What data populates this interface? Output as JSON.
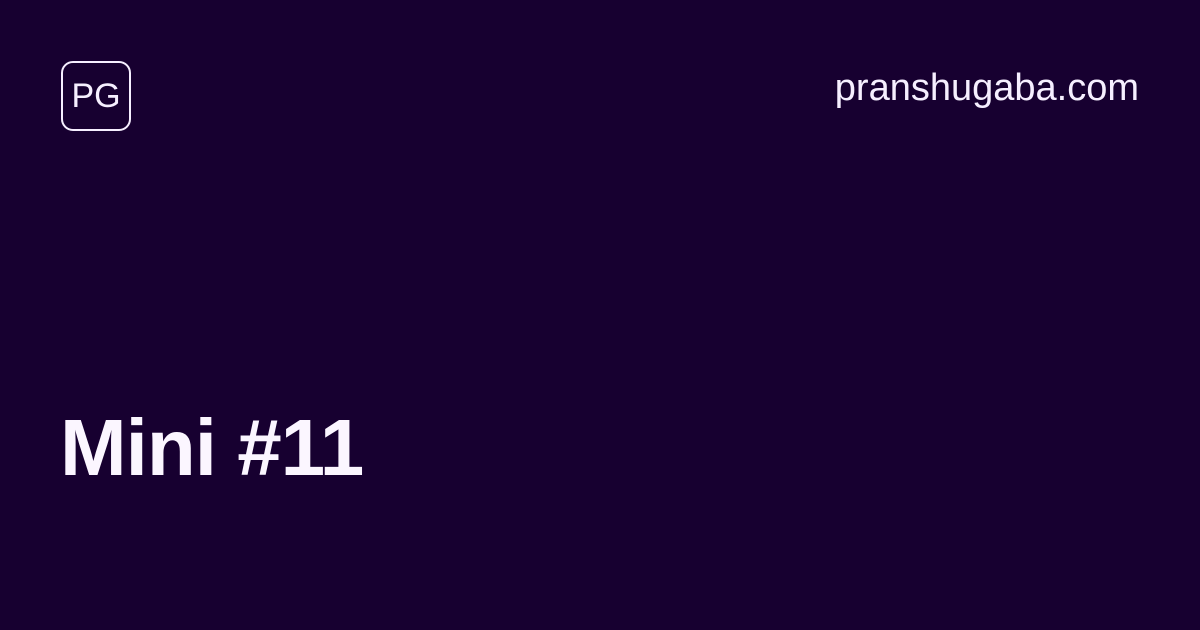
{
  "brand": {
    "logo_text": "PG",
    "site": "pranshugaba.com"
  },
  "post": {
    "title": "Mini #11"
  },
  "colors": {
    "background": "#170030",
    "text": "#f6efff"
  }
}
